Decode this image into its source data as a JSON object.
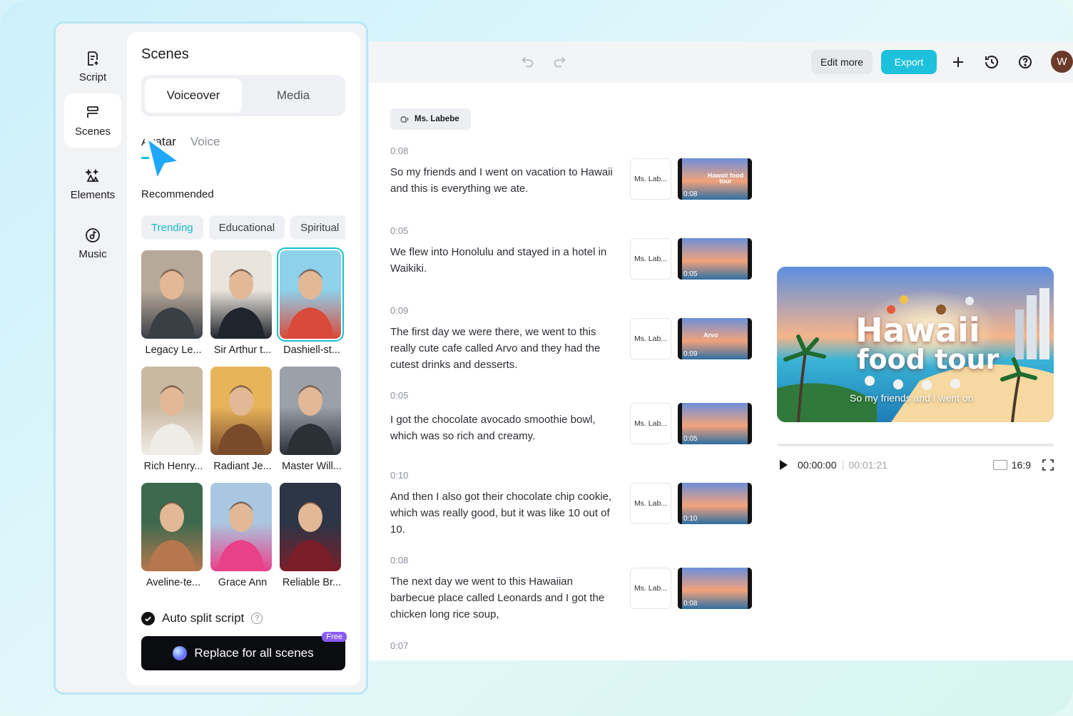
{
  "sidebar": {
    "items": [
      {
        "label": "Script",
        "icon": "script-icon"
      },
      {
        "label": "Scenes",
        "icon": "scenes-icon"
      },
      {
        "label": "Elements",
        "icon": "elements-icon"
      },
      {
        "label": "Music",
        "icon": "music-icon"
      }
    ]
  },
  "panel": {
    "title": "Scenes",
    "tabs": [
      "Voiceover",
      "Media"
    ],
    "subtabs": [
      "Avatar",
      "Voice"
    ],
    "recommended_label": "Recommended",
    "chips": [
      "Trending",
      "Educational",
      "Spiritual"
    ],
    "avatars": [
      {
        "name": "Legacy Le...",
        "colors": [
          "#b7a99a",
          "#3a3f46"
        ]
      },
      {
        "name": "Sir Arthur t...",
        "colors": [
          "#e9e4dc",
          "#20242c"
        ]
      },
      {
        "name": "Dashiell-st...",
        "colors": [
          "#8fd0ea",
          "#d94a3a"
        ]
      },
      {
        "name": "Rich Henry...",
        "colors": [
          "#c9b9a3",
          "#efece6"
        ]
      },
      {
        "name": "Radiant Je...",
        "colors": [
          "#e8b45a",
          "#7a4b2a"
        ]
      },
      {
        "name": "Master Will...",
        "colors": [
          "#9aa1a8",
          "#2b2f36"
        ]
      },
      {
        "name": "Aveline-te...",
        "colors": [
          "#3d6a4e",
          "#b6774e"
        ]
      },
      {
        "name": "Grace Ann",
        "colors": [
          "#a9c7e0",
          "#e9408a"
        ]
      },
      {
        "name": "Reliable Br...",
        "colors": [
          "#2c3646",
          "#7a1e2a"
        ]
      }
    ],
    "auto_split_label": "Auto split script",
    "replace_button": "Replace for all scenes",
    "free_badge": "Free"
  },
  "toolbar": {
    "edit_more": "Edit more",
    "export": "Export",
    "user_initial": "W",
    "accent_color": "#1ec1dc"
  },
  "script": {
    "speaker": "Ms. Labebe",
    "scenes": [
      {
        "duration": "0:08",
        "text": "So my friends and I went on vacation to Hawaii and this is everything we ate.",
        "voice": "Ms. Lab...",
        "thumb_title": "Hawaii food tour"
      },
      {
        "duration": "0:05",
        "text": "We flew into Honolulu and stayed in a hotel in Waikiki.",
        "voice": "Ms. Lab...",
        "thumb_title": ""
      },
      {
        "duration": "0:09",
        "text": "The first day we were there, we went to this really cute cafe called Arvo and they had the cutest drinks and desserts.",
        "voice": "Ms. Lab...",
        "thumb_title": "Arvo"
      },
      {
        "duration": "0:05",
        "text": "I got the chocolate avocado smoothie bowl, which was so rich and creamy.",
        "voice": "Ms. Lab...",
        "thumb_title": ""
      },
      {
        "duration": "0:10",
        "text": "And then I also got their chocolate chip cookie, which was really good, but it was like 10 out of 10.",
        "voice": "Ms. Lab...",
        "thumb_title": ""
      },
      {
        "duration": "0:08",
        "text": "The next day we went to this Hawaiian barbecue place called Leonards and I got the chicken long rice soup,",
        "voice": "Ms. Lab...",
        "thumb_title": ""
      },
      {
        "duration": "0:07",
        "text": "",
        "voice": "",
        "thumb_title": ""
      }
    ]
  },
  "preview": {
    "title_line1": "Hawaii",
    "title_line2": "food tour",
    "subtitle": "So my friends and I went on",
    "current_time": "00:00:00",
    "total_time": "00:01:21",
    "aspect_ratio": "16:9",
    "progress": 0
  }
}
